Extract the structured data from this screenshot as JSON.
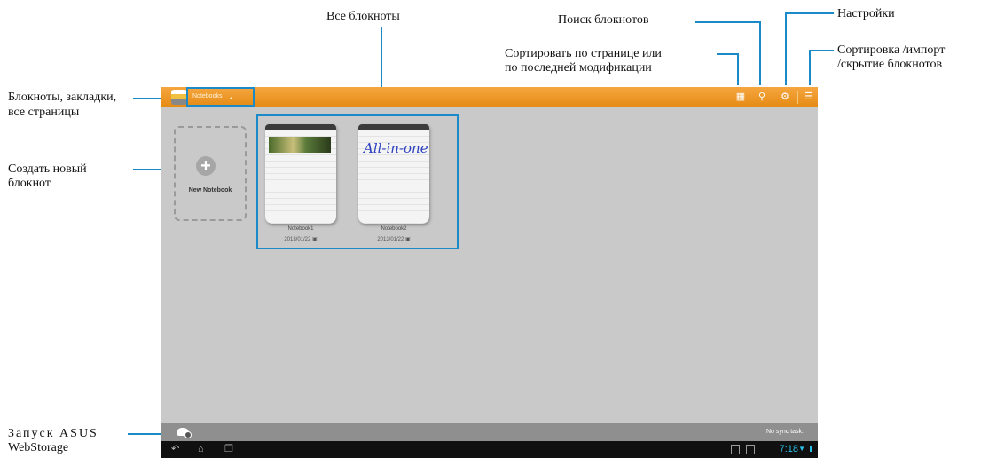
{
  "annotations": {
    "all_notebooks": "Все блокноты",
    "search": "Поиск блокнотов",
    "settings": "Настройки",
    "sort_line1": "Сортировать по странице или",
    "sort_line2": "по последней модификации",
    "manage_line1": "Сортировка /импорт",
    "manage_line2": "/скрытие блокнотов",
    "notebooks_line1": "Блокноты, закладки,",
    "notebooks_line2": "все страницы",
    "create_line1": "Создать новый",
    "create_line2": "блокнот",
    "webstorage_line1": "Запуск ASUS",
    "webstorage_line2": "WebStorage"
  },
  "app": {
    "title": "Notebooks",
    "new_notebook_label": "New Notebook",
    "notebooks": [
      {
        "name": "Notebook1",
        "date": "2013/01/22",
        "cover": "photo"
      },
      {
        "name": "Notebook2",
        "date": "2013/01/22",
        "cover": "All-in-one"
      }
    ],
    "sync_status": "No sync task.",
    "clock": "7:18"
  },
  "colors": {
    "accent": "#1a8bc8",
    "toolbar": "#f0961e",
    "canvas": "#c9c9c9",
    "clock": "#28c0e8"
  },
  "icons": {
    "toolbar": [
      "sort-page-icon",
      "search-icon",
      "gear-icon",
      "manage-notebooks-icon"
    ],
    "navbar": [
      "back-icon",
      "home-icon",
      "recent-apps-icon"
    ]
  }
}
